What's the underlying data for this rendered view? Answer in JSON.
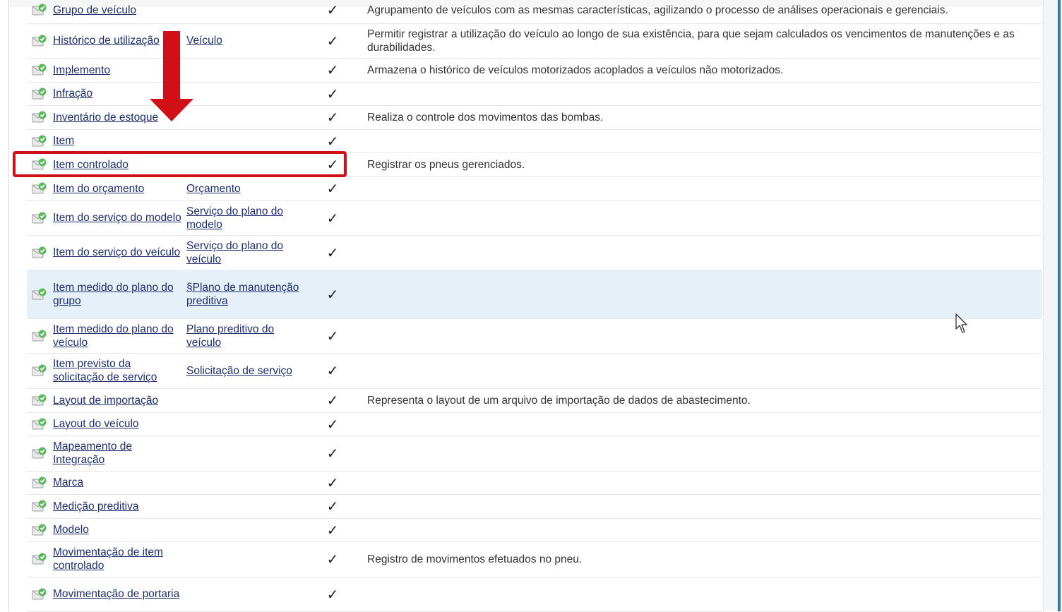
{
  "colors": {
    "link": "#1e2f6e",
    "highlight_row": "#e5f0f9",
    "annotation_red": "#d10f17",
    "icon_green": "#5cb85c"
  },
  "icons": {
    "entity": "entity-doc-icon",
    "check": "checkmark-icon",
    "arrow": "red-down-arrow",
    "cursor": "mouse-pointer-icon"
  },
  "check_glyph": "✓",
  "rows": [
    {
      "name": "Grupo de veículo",
      "parent": "",
      "desc": "Agrupamento de veículos com as mesmas características, agilizando o processo de análises operacionais e gerenciais."
    },
    {
      "name": "Histórico de utilização",
      "parent": "Veículo",
      "desc": "Permitir registrar a utilização do veículo ao longo de sua existência, para que sejam calculados os vencimentos de manutenções e as durabilidades."
    },
    {
      "name": "Implemento",
      "parent": "",
      "desc": "Armazena o histórico de veículos motorizados acoplados a veículos não motorizados."
    },
    {
      "name": "Infração",
      "parent": "",
      "desc": ""
    },
    {
      "name": "Inventário de estoque",
      "parent": "",
      "desc": "Realiza o controle dos movimentos das bombas."
    },
    {
      "name": "Item",
      "parent": "",
      "desc": ""
    },
    {
      "name": "Item controlado",
      "parent": "",
      "desc": "Registrar os pneus gerenciados."
    },
    {
      "name": "Item do orçamento",
      "parent": "Orçamento",
      "desc": ""
    },
    {
      "name": "Item do serviço do modelo",
      "parent": "Serviço do plano do modelo",
      "desc": ""
    },
    {
      "name": "Item do serviço do veículo",
      "parent": "Serviço do plano do veículo",
      "desc": ""
    },
    {
      "name": "Item medido do plano do grupo",
      "parent": "§Plano de manutenção preditiva",
      "desc": ""
    },
    {
      "name": "Item medido do plano do veículo",
      "parent": "Plano preditivo do veículo",
      "desc": ""
    },
    {
      "name": "Item previsto da solicitação de serviço",
      "parent": "Solicitação de serviço",
      "desc": ""
    },
    {
      "name": "Layout de importação",
      "parent": "",
      "desc": "Representa o layout de um arquivo de importação de dados de abastecimento."
    },
    {
      "name": "Layout do veículo",
      "parent": "",
      "desc": ""
    },
    {
      "name": "Mapeamento de Integração",
      "parent": "",
      "desc": ""
    },
    {
      "name": "Marca",
      "parent": "",
      "desc": ""
    },
    {
      "name": "Medição preditiva",
      "parent": "",
      "desc": ""
    },
    {
      "name": "Modelo",
      "parent": "",
      "desc": ""
    },
    {
      "name": "Movimentação de item controlado",
      "parent": "",
      "desc": "Registro de movimentos efetuados no pneu."
    },
    {
      "name": "Movimentação de portaria",
      "parent": "",
      "desc": ""
    }
  ]
}
